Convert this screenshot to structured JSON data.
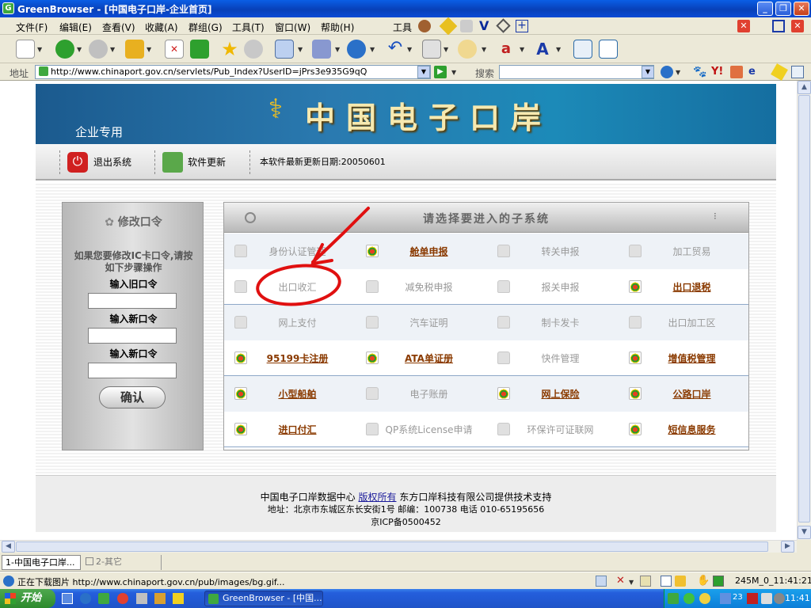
{
  "window": {
    "title": "GreenBrowser - [中国电子口岸-企业首页]"
  },
  "menu": [
    "文件(F)",
    "编辑(E)",
    "查看(V)",
    "收藏(A)",
    "群组(G)",
    "工具(T)",
    "窗口(W)",
    "帮助(H)"
  ],
  "menu_tools_label": "工具",
  "address_bar": {
    "label": "地址",
    "url": "http://www.chinaport.gov.cn/servlets/Pub_Index?UserID=jPrs3e935G9qQ",
    "search_label": "搜索",
    "search_value": ""
  },
  "banner": {
    "title": "中国电子口岸",
    "subtitle": "企业专用"
  },
  "actions": {
    "logout": "退出系统",
    "update": "软件更新",
    "update_date": "本软件最新更新日期:20050601"
  },
  "password_panel": {
    "title": "修改口令",
    "note": "如果您要修改IC卡口令,请按如下步骤操作",
    "old_label": "输入旧口令",
    "new_label": "输入新口令",
    "confirm_new_label": "输入新口令",
    "confirm_button": "确认"
  },
  "subsystem_panel": {
    "title": "请选择要进入的子系统",
    "rows": [
      [
        {
          "label": "身份认证管理",
          "enabled": false
        },
        {
          "label": "舱单申报",
          "enabled": true
        },
        {
          "label": "转关申报",
          "enabled": false
        },
        {
          "label": "加工贸易",
          "enabled": false
        }
      ],
      [
        {
          "label": "出口收汇",
          "enabled": false
        },
        {
          "label": "减免税申报",
          "enabled": false
        },
        {
          "label": "报关申报",
          "enabled": false
        },
        {
          "label": "出口退税",
          "enabled": true
        }
      ],
      [
        {
          "label": "网上支付",
          "enabled": false
        },
        {
          "label": "汽车证明",
          "enabled": false
        },
        {
          "label": "制卡发卡",
          "enabled": false
        },
        {
          "label": "出口加工区",
          "enabled": false
        }
      ],
      [
        {
          "label": "95199卡注册",
          "enabled": true
        },
        {
          "label": "ATA单证册",
          "enabled": true
        },
        {
          "label": "快件管理",
          "enabled": false
        },
        {
          "label": "增值税管理",
          "enabled": true
        }
      ],
      [
        {
          "label": "小型船舶",
          "enabled": true
        },
        {
          "label": "电子账册",
          "enabled": false
        },
        {
          "label": "网上保险",
          "enabled": true
        },
        {
          "label": "公路口岸",
          "enabled": true
        }
      ],
      [
        {
          "label": "进口付汇",
          "enabled": true
        },
        {
          "label": "QP系统License申请",
          "enabled": false
        },
        {
          "label": "环保许可证联网",
          "enabled": false
        },
        {
          "label": "短信息服务",
          "enabled": true
        }
      ]
    ]
  },
  "footer": {
    "line1_a": "中国电子口岸数据中心",
    "line1_link": "版权所有",
    "line1_b": "东方口岸科技有限公司提供技术支持",
    "line2": "地址：北京市东城区东长安街1号 邮编：100738 电话 010-65195656",
    "line3": "京ICP备0500452"
  },
  "tabs": [
    {
      "label": "1-中国电子口岸..."
    },
    {
      "label": "2-其它"
    }
  ],
  "status": {
    "text": "正在下载图片 http://www.chinaport.gov.cn/pub/images/bg.gif...",
    "memory": "245M_0_11:41:21"
  },
  "taskbar": {
    "start": "开始",
    "task": "GreenBrowser - [中国...",
    "clock": "11:41",
    "tray_num": "23"
  },
  "colors": {
    "banner": "#1b6ea3",
    "link": "#8a3a00",
    "annotation": "#e01010"
  }
}
